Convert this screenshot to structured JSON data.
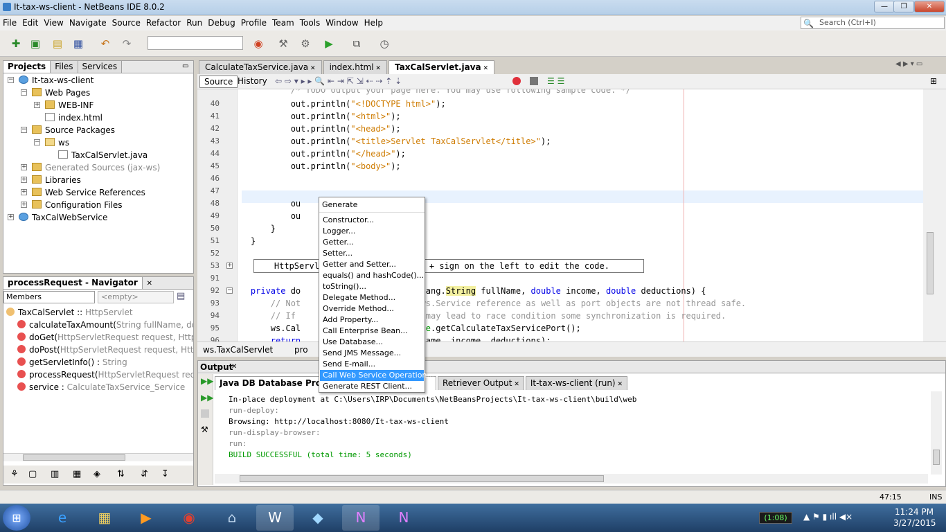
{
  "window": {
    "title": "It-tax-ws-client - NetBeans IDE 8.0.2",
    "min": "—",
    "max": "❐",
    "close": "✕"
  },
  "menu": [
    "File",
    "Edit",
    "View",
    "Navigate",
    "Source",
    "Refactor",
    "Run",
    "Debug",
    "Profile",
    "Team",
    "Tools",
    "Window",
    "Help"
  ],
  "search": {
    "placeholder": "Search (Ctrl+I)"
  },
  "projects": {
    "tabs": [
      "Projects",
      "Files",
      "Services"
    ],
    "tree": [
      {
        "label": "It-tax-ws-client",
        "level": 0,
        "icon": "globe",
        "exp": "−"
      },
      {
        "label": "Web Pages",
        "level": 1,
        "icon": "fold",
        "exp": "−"
      },
      {
        "label": "WEB-INF",
        "level": 2,
        "icon": "fold",
        "exp": "+"
      },
      {
        "label": "index.html",
        "level": 2,
        "icon": "fileic",
        "exp": ""
      },
      {
        "label": "Source Packages",
        "level": 1,
        "icon": "fold",
        "exp": "−"
      },
      {
        "label": "ws",
        "level": 2,
        "icon": "pkg",
        "exp": "−"
      },
      {
        "label": "TaxCalServlet.java",
        "level": 3,
        "icon": "fileic",
        "exp": ""
      },
      {
        "label": "Generated Sources (jax-ws)",
        "level": 1,
        "icon": "fold",
        "exp": "+",
        "muted": true
      },
      {
        "label": "Libraries",
        "level": 1,
        "icon": "fold",
        "exp": "+"
      },
      {
        "label": "Web Service References",
        "level": 1,
        "icon": "fold",
        "exp": "+"
      },
      {
        "label": "Configuration Files",
        "level": 1,
        "icon": "fold",
        "exp": "+"
      },
      {
        "label": "TaxCalWebService",
        "level": 0,
        "icon": "globe",
        "exp": "+"
      }
    ]
  },
  "navigator": {
    "title": "processRequest - Navigator",
    "filter": "Members",
    "empty": "<empty>",
    "items": [
      {
        "name": "TaxCalServlet :: ",
        "type": "HttpServlet"
      },
      {
        "name": "calculateTaxAmount(",
        "type": "String fullName, double inco"
      },
      {
        "name": "doGet(",
        "type": "HttpServletRequest request, HttpServlet"
      },
      {
        "name": "doPost(",
        "type": "HttpServletRequest request, HttpServle"
      },
      {
        "name": "getServletInfo() : ",
        "type": "String"
      },
      {
        "name": "processRequest(",
        "type": "HttpServletRequest request, Ht"
      },
      {
        "name": "service : ",
        "type": "CalculateTaxService_Service"
      }
    ]
  },
  "editor": {
    "tabs": [
      "CalculateTaxService.java",
      "index.html",
      "TaxCalServlet.java"
    ],
    "active_tab": 2,
    "source_tab": "Source",
    "history_tab": "History",
    "breadcrumb": [
      "ws.TaxCalServlet",
      "pro"
    ],
    "first_line": "            /* TODO output your page here. You may use following sample code. */",
    "lines": [
      {
        "n": "40",
        "code": [
          [
            "            out.println(",
            ""
          ],
          [
            "\"<!DOCTYPE html>\"",
            "str"
          ],
          [
            ");",
            ""
          ]
        ]
      },
      {
        "n": "41",
        "code": [
          [
            "            out.println(",
            ""
          ],
          [
            "\"<html>\"",
            "str"
          ],
          [
            ");",
            ""
          ]
        ]
      },
      {
        "n": "42",
        "code": [
          [
            "            out.println(",
            ""
          ],
          [
            "\"<head>\"",
            "str"
          ],
          [
            ");",
            ""
          ]
        ]
      },
      {
        "n": "43",
        "code": [
          [
            "            out.println(",
            ""
          ],
          [
            "\"<title>Servlet TaxCalServlet</title>\"",
            "str"
          ],
          [
            ");",
            ""
          ]
        ]
      },
      {
        "n": "44",
        "code": [
          [
            "            out.println(",
            ""
          ],
          [
            "\"</head>\"",
            "str"
          ],
          [
            ");",
            ""
          ]
        ]
      },
      {
        "n": "45",
        "code": [
          [
            "            out.println(",
            ""
          ],
          [
            "\"<body>\"",
            "str"
          ],
          [
            ");",
            ""
          ]
        ]
      },
      {
        "n": "46",
        "code": []
      },
      {
        "n": "47",
        "code": []
      },
      {
        "n": "48",
        "code": [
          [
            "            ou",
            ""
          ],
          [
            "                ",
            ""
          ],
          [
            ");",
            ""
          ]
        ]
      },
      {
        "n": "49",
        "code": [
          [
            "            ou",
            ""
          ],
          [
            "                ",
            ""
          ],
          [
            ");",
            ""
          ]
        ]
      },
      {
        "n": "50",
        "code": [
          [
            "        }",
            ""
          ]
        ]
      },
      {
        "n": "51",
        "code": [
          [
            "    }",
            ""
          ]
        ]
      },
      {
        "n": "52",
        "code": []
      },
      {
        "n": "53",
        "code": [
          [
            "    HttpServle",
            ""
          ],
          [
            "              ",
            ""
          ],
          [
            "   the + sign on the left to edit the code.",
            ""
          ]
        ]
      },
      {
        "n": "91",
        "code": []
      },
      {
        "n": "92",
        "code": [
          [
            "    ",
            ""
          ],
          [
            "private",
            "kw"
          ],
          [
            " do",
            ""
          ],
          [
            "              ",
            ""
          ],
          [
            "ount(java.lang.",
            ""
          ],
          [
            "String",
            "hl"
          ],
          [
            " fullName, ",
            ""
          ],
          [
            "double",
            "kw"
          ],
          [
            " income, ",
            ""
          ],
          [
            "double",
            "kw"
          ],
          [
            " deductions) {",
            ""
          ]
        ]
      },
      {
        "n": "93",
        "code": [
          [
            "        ",
            ""
          ],
          [
            "// Not",
            "cm"
          ],
          [
            "              ",
            ""
          ],
          [
            "javax.xml.ws.Service reference as well as port objects are not thread safe.",
            "cm"
          ]
        ]
      },
      {
        "n": "94",
        "code": [
          [
            "        ",
            ""
          ],
          [
            "// If ",
            "cm"
          ],
          [
            "              ",
            ""
          ],
          [
            "operations may lead to race condition some synchronization is required.",
            "cm"
          ]
        ]
      },
      {
        "n": "95",
        "code": [
          [
            "        ws.Cal",
            ""
          ],
          [
            "              ",
            ""
          ],
          [
            "rt = ",
            ""
          ],
          [
            "service",
            "fn"
          ],
          [
            ".getCalculateTaxServicePort();",
            ""
          ]
        ]
      },
      {
        "n": "96",
        "code": [
          [
            "        ",
            ""
          ],
          [
            "return",
            "kw"
          ],
          [
            "              ",
            ""
          ],
          [
            "mount(fullName, income, deductions);",
            ""
          ]
        ]
      }
    ]
  },
  "popup": {
    "header": "Generate",
    "items": [
      "Constructor...",
      "Logger...",
      "Getter...",
      "Setter...",
      "Getter and Setter...",
      "equals() and hashCode()...",
      "toString()...",
      "Delegate Method...",
      "Override Method...",
      "Add Property...",
      "Call Enterprise Bean...",
      "Use Database...",
      "Send JMS Message...",
      "Send E-mail...",
      "Call Web Service Operation...",
      "Generate REST Client..."
    ],
    "selected": 14
  },
  "output": {
    "title": "Output",
    "tabs": [
      "Java DB Database Process",
      "Retriever Output",
      "It-tax-ws-client (run)"
    ],
    "lines": [
      {
        "t": "In-place deployment at C:\\Users\\IRP\\Documents\\NetBeansProjects\\It-tax-ws-client\\build\\web",
        "c": "#000000"
      },
      {
        "t": "run-deploy:",
        "c": "#808080"
      },
      {
        "t": "Browsing: http://localhost:8080/It-tax-ws-client",
        "c": "#000000"
      },
      {
        "t": "run-display-browser:",
        "c": "#808080"
      },
      {
        "t": "run:",
        "c": "#808080"
      },
      {
        "t": "BUILD SUCCESSFUL (total time: 5 seconds)",
        "c": "#009900"
      }
    ]
  },
  "status": {
    "position": "47:15",
    "mode": "INS"
  },
  "taskbar": {
    "battery": "(1:08)",
    "time": "11:24 PM",
    "date": "3/27/2015"
  }
}
